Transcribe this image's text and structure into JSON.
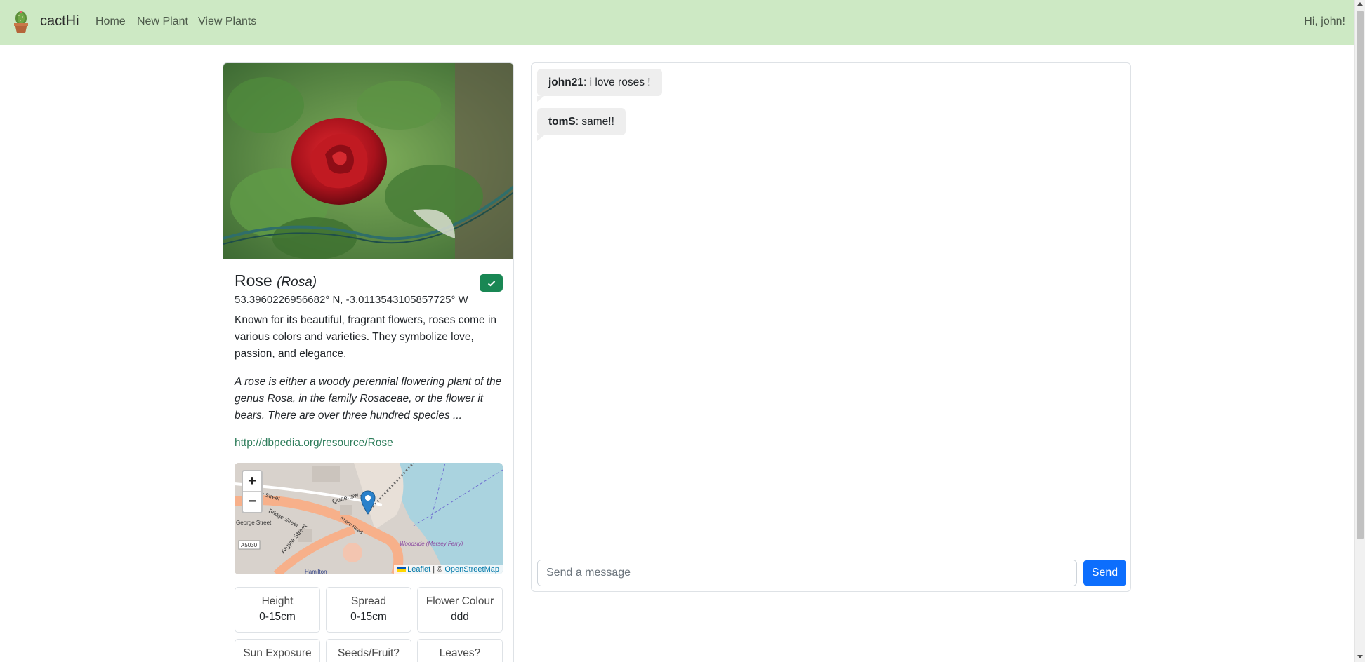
{
  "navbar": {
    "brand": "cactHi",
    "links": [
      "Home",
      "New Plant",
      "View Plants"
    ],
    "greeting": "Hi, john!"
  },
  "plant": {
    "name": "Rose",
    "scientific_name": "(Rosa)",
    "identified_icon": "check-icon",
    "coordinates": "53.3960226956682° N, -3.0113543105857725° W",
    "description": "Known for its beautiful, fragrant flowers, roses come in various colors and varieties. They symbolize love, passion, and elegance.",
    "abstract": "A rose is either a woody perennial flowering plant of the genus Rosa, in the family Rosaceae, or the flower it bears. There are over three hundred species ...",
    "dbpedia_link": "http://dbpedia.org/resource/Rose",
    "map": {
      "zoom_in": "+",
      "zoom_out": "−",
      "attribution_leaflet": "Leaflet",
      "attribution_sep": " | © ",
      "attribution_osm": "OpenStreetMap",
      "street_labels": [
        "...ning Street",
        "Bridge Street",
        "George Street",
        "Argyle Street",
        "Queensw...",
        "Shore Road",
        "A5030",
        "Woodside (Mersey Ferry)",
        "Hamilton"
      ]
    },
    "attributes": [
      {
        "label": "Height",
        "value": "0-15cm"
      },
      {
        "label": "Spread",
        "value": "0-15cm"
      },
      {
        "label": "Flower Colour",
        "value": "ddd"
      },
      {
        "label": "Sun Exposure",
        "value": ""
      },
      {
        "label": "Seeds/Fruit?",
        "value": ""
      },
      {
        "label": "Leaves?",
        "value": ""
      }
    ]
  },
  "chat": {
    "messages": [
      {
        "user": "john21",
        "text": ": i love roses !"
      },
      {
        "user": "tomS",
        "text": ": same!!"
      }
    ],
    "input_placeholder": "Send a message",
    "send_label": "Send"
  },
  "colors": {
    "navbar_bg": "#cde9c4",
    "success": "#198754",
    "primary": "#0d6efd",
    "link": "#2e7d5b"
  }
}
